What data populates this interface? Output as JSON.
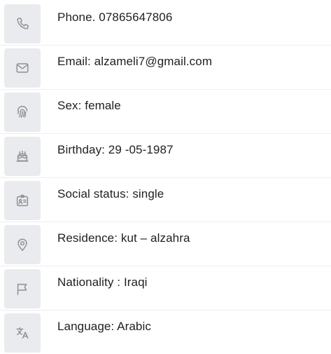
{
  "contact_info": {
    "items": [
      {
        "icon": "phone-icon",
        "text": "Phone. 07865647806"
      },
      {
        "icon": "mail-icon",
        "text": "Email: alzameli7@gmail.com"
      },
      {
        "icon": "fingerprint-icon",
        "text": "Sex: female"
      },
      {
        "icon": "cake-icon",
        "text": "Birthday: 29 -05-1987"
      },
      {
        "icon": "id-card-icon",
        "text": "Social status: single"
      },
      {
        "icon": "location-pin-icon",
        "text": "Residence: kut – alzahra"
      },
      {
        "icon": "flag-icon",
        "text": "Nationality : Iraqi"
      },
      {
        "icon": "translate-icon",
        "text": "Language: Arabic"
      }
    ]
  }
}
